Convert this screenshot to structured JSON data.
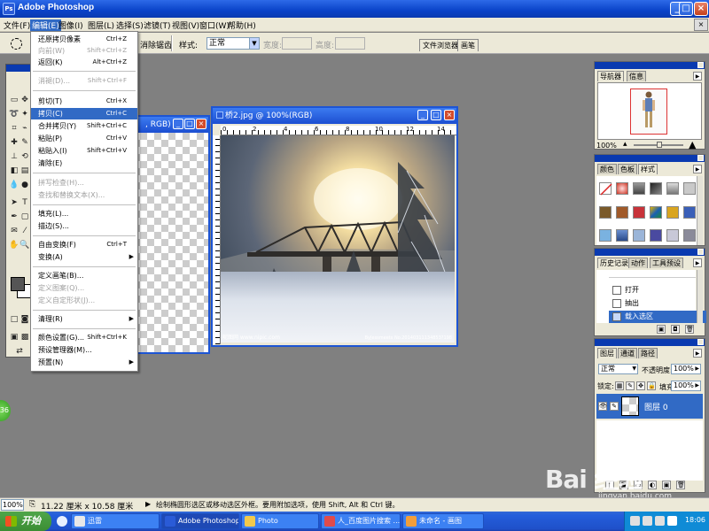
{
  "window": {
    "title": "Adobe Photoshop"
  },
  "menubar": {
    "items": [
      "文件(F)",
      "编辑(E)",
      "图像(I)",
      "图层(L)",
      "选择(S)",
      "滤镜(T)",
      "视图(V)",
      "窗口(W)",
      "帮助(H)"
    ],
    "active": "编辑(E)"
  },
  "options": {
    "fade_edges_label": "消除锯齿",
    "style_label": "样式:",
    "style_value": "正常",
    "width_label": "宽度:",
    "height_label": "高度:",
    "palette_tabs": [
      "文件浏览器",
      "画笔"
    ]
  },
  "edit_menu": {
    "items": [
      {
        "label": "还原拷贝像素",
        "shortcut": "Ctrl+Z",
        "state": "normal"
      },
      {
        "label": "向前(W)",
        "shortcut": "Shift+Ctrl+Z",
        "state": "disabled"
      },
      {
        "label": "返回(K)",
        "shortcut": "Alt+Ctrl+Z",
        "state": "normal"
      },
      {
        "label": "消褪(D)...",
        "shortcut": "Shift+Ctrl+F",
        "state": "disabled"
      },
      {
        "label": "剪切(T)",
        "shortcut": "Ctrl+X",
        "state": "normal"
      },
      {
        "label": "拷贝(C)",
        "shortcut": "Ctrl+C",
        "state": "highlight"
      },
      {
        "label": "合并拷贝(Y)",
        "shortcut": "Shift+Ctrl+C",
        "state": "normal"
      },
      {
        "label": "粘贴(P)",
        "shortcut": "Ctrl+V",
        "state": "normal"
      },
      {
        "label": "粘贴入(I)",
        "shortcut": "Shift+Ctrl+V",
        "state": "normal"
      },
      {
        "label": "清除(E)",
        "shortcut": "",
        "state": "normal"
      },
      {
        "label": "拼写检查(H)...",
        "shortcut": "",
        "state": "disabled"
      },
      {
        "label": "查找和替换文本(X)...",
        "shortcut": "",
        "state": "disabled"
      },
      {
        "label": "填充(L)...",
        "shortcut": "",
        "state": "normal"
      },
      {
        "label": "描边(S)...",
        "shortcut": "",
        "state": "normal"
      },
      {
        "label": "自由变换(F)",
        "shortcut": "Ctrl+T",
        "state": "normal"
      },
      {
        "label": "变换(A)",
        "shortcut": "",
        "state": "normal",
        "submenu": true
      },
      {
        "label": "定义画笔(B)...",
        "shortcut": "",
        "state": "normal"
      },
      {
        "label": "定义图案(Q)...",
        "shortcut": "",
        "state": "disabled"
      },
      {
        "label": "定义自定形状(J)...",
        "shortcut": "",
        "state": "disabled"
      },
      {
        "label": "清理(R)",
        "shortcut": "",
        "state": "normal",
        "submenu": true
      },
      {
        "label": "颜色设置(G)...",
        "shortcut": "Shift+Ctrl+K",
        "state": "normal"
      },
      {
        "label": "预设管理器(M)...",
        "shortcut": "",
        "state": "normal"
      },
      {
        "label": "预置(N)",
        "shortcut": "",
        "state": "normal",
        "submenu": true
      }
    ]
  },
  "doc_back": {
    "title_fragment": ", RGB)"
  },
  "doc_front": {
    "title": "桥2.jpg @ 100%(RGB)",
    "ruler_numbers": [
      "0",
      "2",
      "4",
      "6",
      "8",
      "10",
      "12",
      "14"
    ],
    "watermark_left": "昵图网 www.nipic.com",
    "watermark_right": "ByJessmeets No.20140311134853?198"
  },
  "panels": {
    "navigator": {
      "tabs": [
        "导航器",
        "信息"
      ],
      "zoom": "100%"
    },
    "swatches": {
      "tabs": [
        "颜色",
        "色板",
        "样式"
      ]
    },
    "history": {
      "tabs": [
        "历史记录",
        "动作",
        "工具预设"
      ],
      "items": [
        {
          "label": "打开",
          "current": false
        },
        {
          "label": "抽出",
          "current": false
        },
        {
          "label": "载入选区",
          "current": true
        }
      ]
    },
    "layers": {
      "tabs": [
        "图层",
        "通道",
        "路径"
      ],
      "blend_mode": "正常",
      "opacity_label": "不透明度:",
      "opacity_value": "100%",
      "lock_label": "锁定:",
      "fill_label": "填充:",
      "fill_value": "100%",
      "layer_name": "图层 0"
    }
  },
  "statusbar": {
    "zoom": "100%",
    "doc_size": "11.22 厘米 x 10.58 厘米",
    "hint": "绘制椭圆形选区或移动选区外框。要用附加选项，使用 Shift, Alt 和 Ctrl 键。"
  },
  "taskbar": {
    "start_label": "开始",
    "tasks": [
      "迅雷",
      "Adobe Photoshop",
      "Photo",
      "人_百度图片搜索 ...",
      "未命名 - 画图"
    ],
    "clock": "18:06"
  },
  "badge": "36",
  "watermark": {
    "brand": "Bai 经验",
    "url": "jingyan.baidu.com"
  },
  "colors": {
    "title_blue": "#0a43c8",
    "menu_highlight": "#316ac5",
    "workspace_gray": "#808080",
    "start_green": "#3b8d33"
  }
}
